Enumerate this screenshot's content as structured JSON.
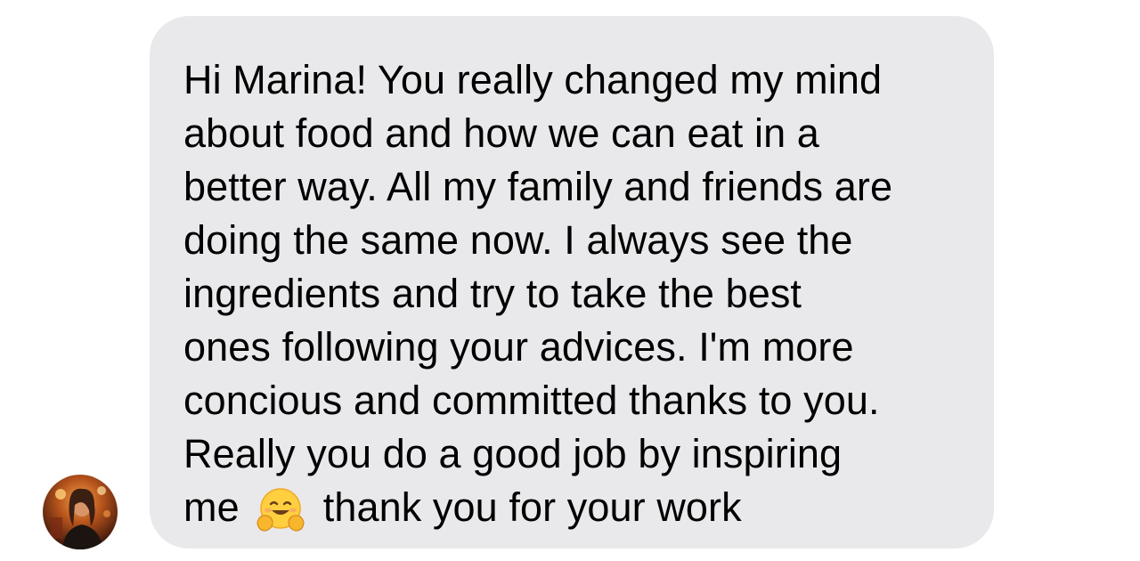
{
  "conversation": {
    "message": {
      "lines": [
        "Hi Marina! You really changed my mind",
        "about food and how we can eat in a",
        "better way. All my family and friends are",
        "doing the same now. I always see the",
        "ingredients and try to take the best",
        "ones following your advices. I'm more",
        "concious and committed thanks to you.",
        "Really you do a good job by inspiring"
      ],
      "last_line_before_emoji": "me",
      "emoji": "hugging-face-emoji",
      "last_line_after_emoji": "thank you for your work"
    },
    "avatar": "sender-avatar"
  },
  "colors": {
    "bubble_background": "#e9e9eb",
    "text": "#000000",
    "page_background": "#ffffff"
  }
}
